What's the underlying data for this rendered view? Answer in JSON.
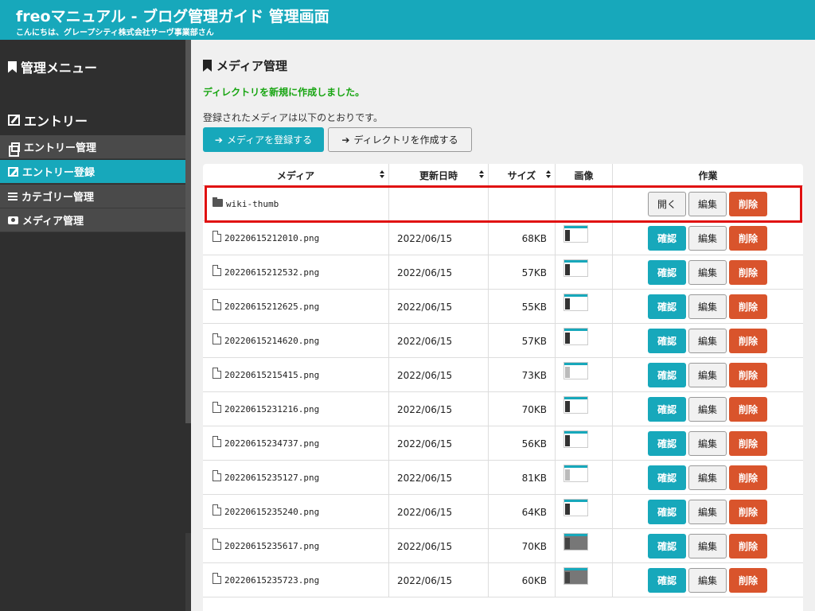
{
  "header": {
    "title": "freoマニュアル - ブログ管理ガイド 管理画面",
    "greeting": "こんにちは、グレープシティ株式会社サーヴ事業部さん"
  },
  "sidebar": {
    "menu_heading": "管理メニュー",
    "entry_heading": "エントリー",
    "items": [
      {
        "label": "エントリー管理",
        "icon": "copy-icon",
        "active": false
      },
      {
        "label": "エントリー登録",
        "icon": "edit-icon",
        "active": true
      },
      {
        "label": "カテゴリー管理",
        "icon": "list-icon",
        "active": false
      },
      {
        "label": "メディア管理",
        "icon": "camera-icon",
        "active": false
      }
    ]
  },
  "main": {
    "heading": "メディア管理",
    "success_message": "ディレクトリを新規に作成しました。",
    "intro": "登録されたメディアは以下のとおりです。",
    "register_button": "メディアを登録する",
    "create_dir_button": "ディレクトリを作成する",
    "columns": {
      "media": "メディア",
      "updated": "更新日時",
      "size": "サイズ",
      "image": "画像",
      "actions": "作業"
    },
    "actions": {
      "open": "開く",
      "confirm": "確認",
      "edit": "編集",
      "delete": "削除"
    },
    "directory": {
      "name": "wiki-thumb"
    },
    "files": [
      {
        "name": "20220615212010.png",
        "date": "2022/06/15",
        "size": "68KB"
      },
      {
        "name": "20220615212532.png",
        "date": "2022/06/15",
        "size": "57KB"
      },
      {
        "name": "20220615212625.png",
        "date": "2022/06/15",
        "size": "55KB"
      },
      {
        "name": "20220615214620.png",
        "date": "2022/06/15",
        "size": "57KB"
      },
      {
        "name": "20220615215415.png",
        "date": "2022/06/15",
        "size": "73KB"
      },
      {
        "name": "20220615231216.png",
        "date": "2022/06/15",
        "size": "70KB"
      },
      {
        "name": "20220615234737.png",
        "date": "2022/06/15",
        "size": "56KB"
      },
      {
        "name": "20220615235127.png",
        "date": "2022/06/15",
        "size": "81KB"
      },
      {
        "name": "20220615235240.png",
        "date": "2022/06/15",
        "size": "64KB"
      },
      {
        "name": "20220615235617.png",
        "date": "2022/06/15",
        "size": "70KB"
      },
      {
        "name": "20220615235723.png",
        "date": "2022/06/15",
        "size": "60KB"
      }
    ]
  },
  "colors": {
    "accent": "#17a8bb",
    "sidebar_bg": "#2f2f2f",
    "success": "#18a512",
    "danger": "#d9542c",
    "highlight": "#e01010"
  }
}
